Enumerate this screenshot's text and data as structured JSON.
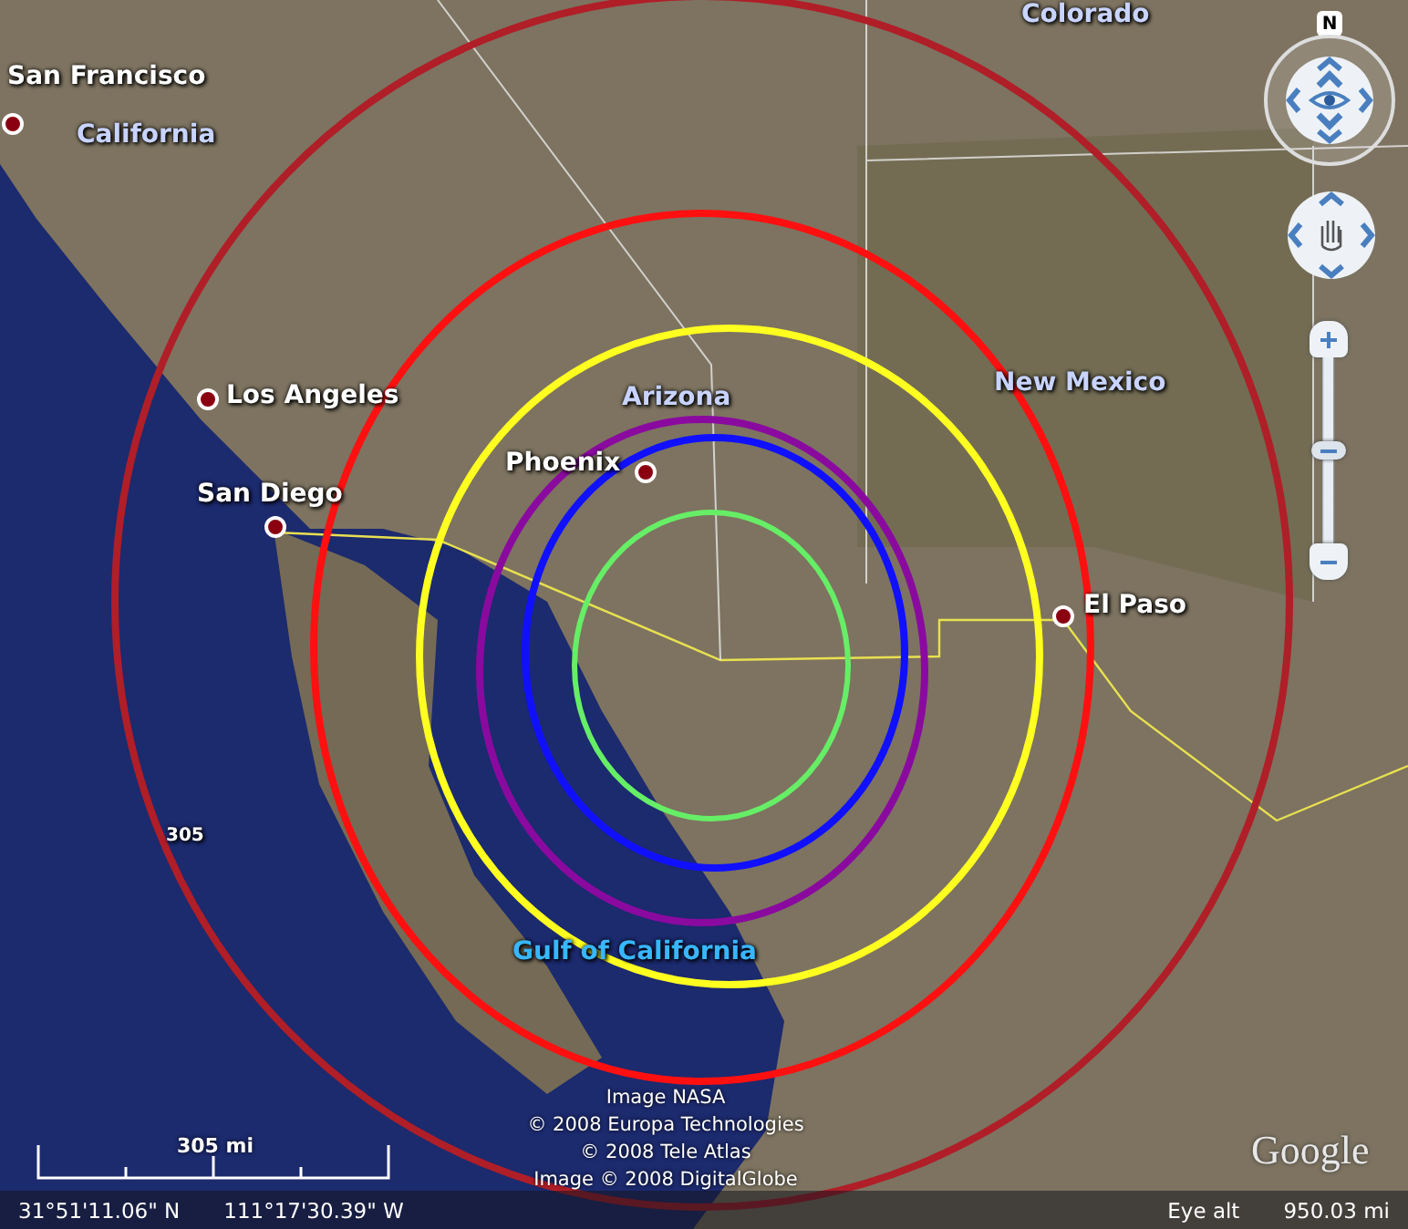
{
  "map": {
    "labels": [
      {
        "text": "Colorado",
        "kind": "region"
      },
      {
        "text": "San Francisco",
        "kind": "city"
      },
      {
        "text": "California",
        "kind": "region"
      },
      {
        "text": "Los Angeles",
        "kind": "city"
      },
      {
        "text": "San Diego",
        "kind": "city"
      },
      {
        "text": "Arizona",
        "kind": "region"
      },
      {
        "text": "Phoenix",
        "kind": "city"
      },
      {
        "text": "New Mexico",
        "kind": "region"
      },
      {
        "text": "El Paso",
        "kind": "city"
      },
      {
        "text": "305",
        "kind": "mark"
      },
      {
        "text": "Gulf of California",
        "kind": "water"
      }
    ],
    "rings": [
      {
        "color": "#b01e28"
      },
      {
        "color": "#ff1010"
      },
      {
        "color": "#ffff20"
      },
      {
        "color": "#8a0aa0"
      },
      {
        "color": "#1010ff"
      },
      {
        "color": "#66ee66"
      }
    ],
    "attribution": [
      "Image NASA",
      "© 2008 Europa Technologies",
      "© 2008 Tele Atlas",
      "Image © 2008 DigitalGlobe"
    ],
    "logo": "Google",
    "scale": "305 mi"
  },
  "navigation": {
    "north": "N",
    "zoom": {
      "level": 0.5
    }
  },
  "status_bar": {
    "latitude": "31°51'11.06\" N",
    "longitude": "111°17'30.39\" W",
    "eye_alt_label": "Eye alt",
    "eye_alt": "950.03 mi"
  }
}
